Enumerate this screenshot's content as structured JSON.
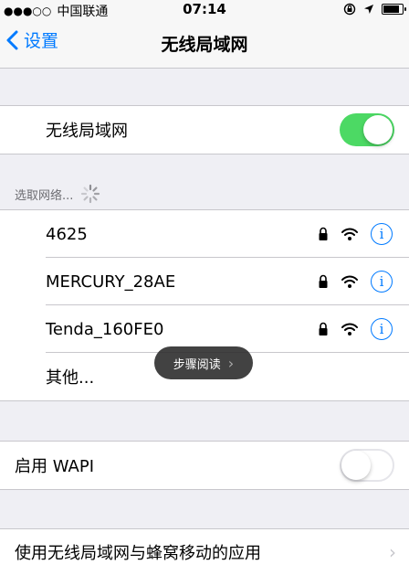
{
  "status_bar": {
    "signal_dots": "●●●○○",
    "carrier": "中国联通",
    "time": "07:14",
    "battery_level": 0.9
  },
  "nav": {
    "back_label": "设置",
    "title": "无线局域网"
  },
  "wifi_toggle": {
    "label": "无线局域网",
    "state": "on"
  },
  "network_section": {
    "header": "选取网络..."
  },
  "networks": [
    {
      "name": "4625",
      "locked": true,
      "info_icon": "i"
    },
    {
      "name": "MERCURY_28AE",
      "locked": true,
      "info_icon": "i"
    },
    {
      "name": "Tenda_160FE0",
      "locked": true,
      "info_icon": "i"
    }
  ],
  "other_network": {
    "label": "其他..."
  },
  "toast": {
    "label": "步骤阅读",
    "chevron": "›"
  },
  "wapi": {
    "label": "启用 WAPI",
    "state": "off"
  },
  "apps_row": {
    "label": "使用无线局域网与蜂窝移动的应用",
    "chevron": "›"
  },
  "colors": {
    "accent": "#007aff",
    "switch_on": "#4cd964",
    "background": "#efeff4"
  }
}
